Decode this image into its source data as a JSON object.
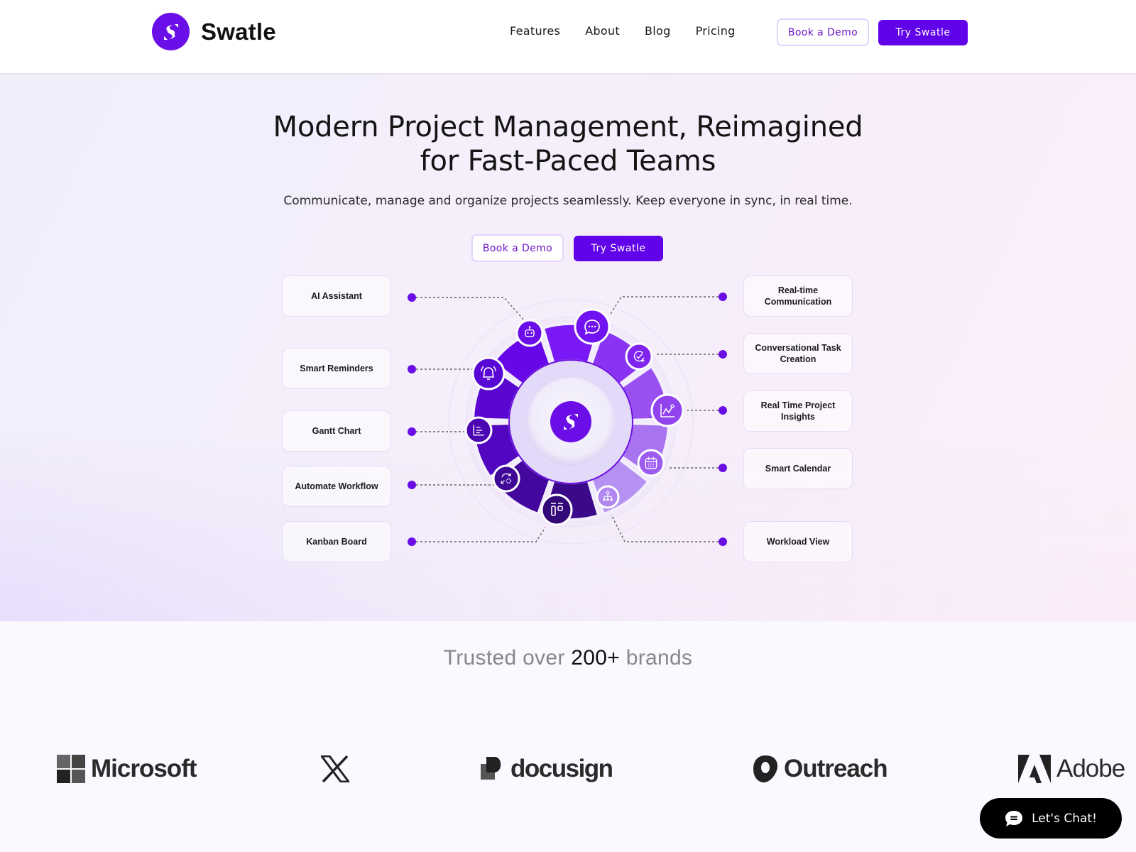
{
  "header": {
    "brand": "Swatle",
    "nav": [
      "Features",
      "About",
      "Blog",
      "Pricing"
    ],
    "book_demo": "Book a Demo",
    "try": "Try Swatle"
  },
  "hero": {
    "title_line1": "Modern Project Management, Reimagined",
    "title_line2": "for Fast-Paced Teams",
    "subtitle": "Communicate, manage and organize projects seamlessly. Keep everyone in sync, in real time.",
    "book_demo": "Book a Demo",
    "try": "Try Swatle"
  },
  "features": {
    "left": [
      {
        "label": "AI Assistant",
        "icon": "robot-icon"
      },
      {
        "label": "Smart Reminders",
        "icon": "bell-icon"
      },
      {
        "label": "Gantt Chart",
        "icon": "gantt-icon"
      },
      {
        "label": "Automate Workflow",
        "icon": "automation-icon"
      },
      {
        "label": "Kanban Board",
        "icon": "kanban-icon"
      }
    ],
    "right": [
      {
        "label": "Real-time Communication",
        "icon": "chat-bubble-icon"
      },
      {
        "label": "Conversational Task Creation",
        "icon": "task-add-icon"
      },
      {
        "label": "Real Time Project Insights",
        "icon": "line-chart-icon"
      },
      {
        "label": "Smart Calendar",
        "icon": "calendar-icon"
      },
      {
        "label": "Workload View",
        "icon": "hierarchy-icon"
      }
    ]
  },
  "colors": {
    "brand": "#6003e8",
    "accent_dot": "#6a0ee6",
    "outline_button_text": "#6b16c8"
  },
  "trusted": {
    "prefix": "Trusted over",
    "count": "200+",
    "suffix": "brands"
  },
  "brands": [
    "Microsoft",
    "X",
    "docusign",
    "Outreach",
    "Adobe"
  ],
  "chat_widget": {
    "label": "Let's Chat!"
  }
}
